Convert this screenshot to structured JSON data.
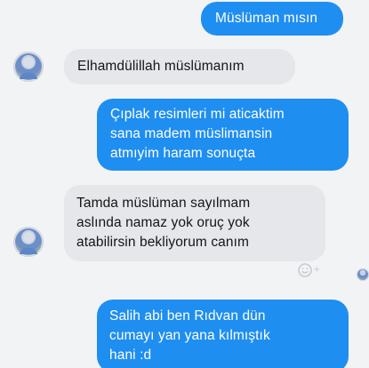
{
  "messages": [
    {
      "direction": "outgoing",
      "lines": [
        "Müslüman mısın"
      ]
    },
    {
      "direction": "incoming",
      "lines": [
        "Elhamdülillah müslümanım"
      ]
    },
    {
      "direction": "outgoing",
      "lines": [
        "Çıplak resimleri mi aticaktim",
        "sana madem müslimansin",
        "atmıyim haram sonuçta"
      ]
    },
    {
      "direction": "incoming",
      "lines": [
        "Tamda müslüman sayılmam",
        "aslında namaz yok oruç yok",
        "atabilirsin bekliyorum canım"
      ]
    },
    {
      "direction": "outgoing",
      "lines": [
        "Salih abi ben Rıdvan dün",
        "cumayı yan yana kılmıştık",
        "hani :d"
      ]
    }
  ],
  "icons": {
    "avatar": "contact-avatar-icon",
    "reaction": "emoji-reaction-icon",
    "seen": "seen-avatar-icon"
  },
  "colors": {
    "outgoing_bubble": "#1f8ef1",
    "incoming_bubble": "#e6e7ea",
    "background": "#f2f3f5"
  }
}
